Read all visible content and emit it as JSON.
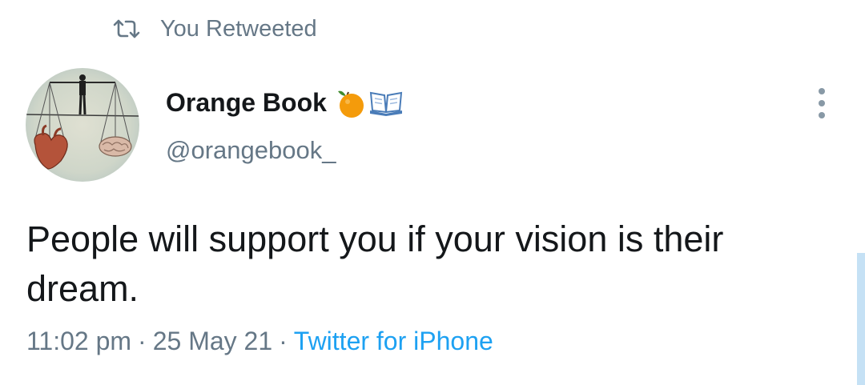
{
  "retweet": {
    "icon": "retweet-icon",
    "label": "You Retweeted"
  },
  "author": {
    "avatar": "avatar-tightrope-heart-brain",
    "display_name": "Orange Book",
    "name_emojis": [
      "tangerine-emoji",
      "open-book-emoji"
    ],
    "handle": "@orangebook_"
  },
  "menu": {
    "icon": "more-vertical-icon"
  },
  "tweet": {
    "text": "People will support you if your vision is their dream.",
    "time": "11:02 pm",
    "separator": "·",
    "date": "25 May 21",
    "source": "Twitter for iPhone"
  },
  "colors": {
    "text_primary": "#14171a",
    "text_secondary": "#657786",
    "link": "#1da1f2",
    "scroll_indicator": "#c5e1f5"
  }
}
